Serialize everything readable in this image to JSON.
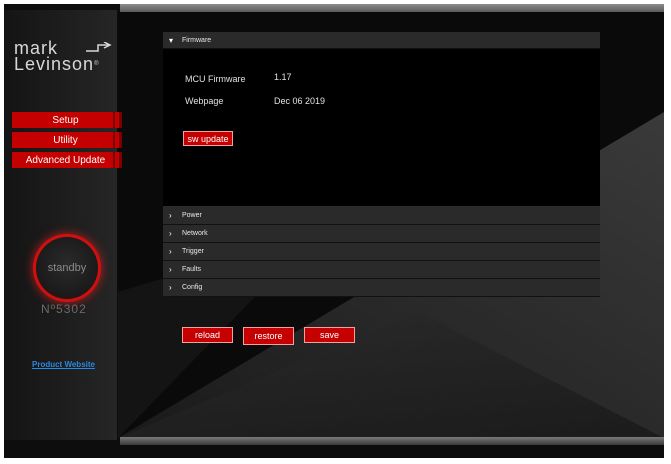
{
  "logo": {
    "line1": "mark",
    "line2": "Levinson",
    "tm": "®"
  },
  "nav": [
    {
      "label": "Setup"
    },
    {
      "label": "Utility"
    },
    {
      "label": "Advanced Update"
    }
  ],
  "standby": {
    "label": "standby"
  },
  "model": "Nº5302",
  "product_link": "Product Website",
  "firmware": {
    "title": "Firmware",
    "mcu_label": "MCU Firmware",
    "mcu_value": "1.17",
    "webpage_label": "Webpage",
    "webpage_value": "Dec 06 2019",
    "sw_update_label": "sw update"
  },
  "sections": [
    {
      "label": "Power"
    },
    {
      "label": "Network"
    },
    {
      "label": "Trigger"
    },
    {
      "label": "Faults"
    },
    {
      "label": "Config"
    }
  ],
  "actions": {
    "reload": "reload",
    "restore": "restore",
    "save": "save"
  },
  "colors": {
    "accent": "#c40000",
    "link": "#2a88e0"
  }
}
